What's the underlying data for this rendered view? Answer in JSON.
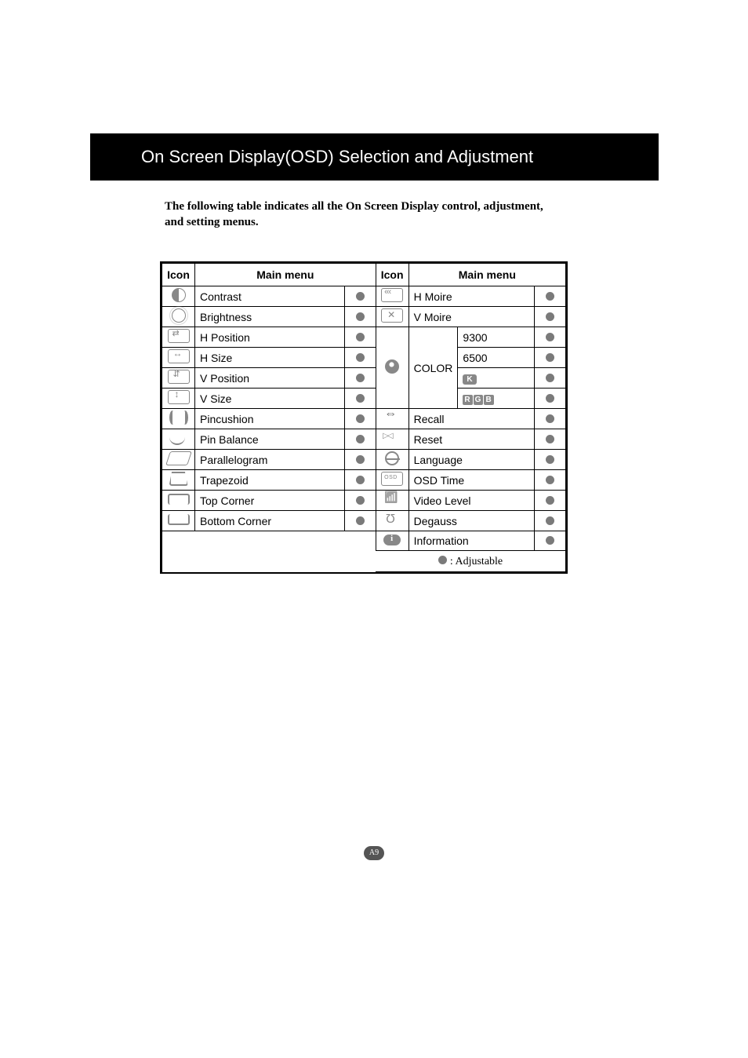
{
  "header": {
    "title": "On Screen Display(OSD) Selection and Adjustment"
  },
  "intro": "The following table indicates all the On Screen Display control, adjustment, and setting menus.",
  "table": {
    "headers": {
      "icon1": "Icon",
      "menu1": "Main menu",
      "icon2": "Icon",
      "menu2": "Main menu"
    },
    "left": [
      {
        "icon": "contrast",
        "label": "Contrast"
      },
      {
        "icon": "brightness",
        "label": "Brightness"
      },
      {
        "icon": "hpos",
        "label": "H Position"
      },
      {
        "icon": "hsize",
        "label": "H Size"
      },
      {
        "icon": "vpos",
        "label": "V Position"
      },
      {
        "icon": "vsize",
        "label": "V Size"
      },
      {
        "icon": "pincushion",
        "label": "Pincushion"
      },
      {
        "icon": "pinbal",
        "label": "Pin Balance"
      },
      {
        "icon": "para",
        "label": "Parallelogram"
      },
      {
        "icon": "trap",
        "label": "Trapezoid"
      },
      {
        "icon": "topcorner",
        "label": "Top Corner"
      },
      {
        "icon": "botcorner",
        "label": "Bottom Corner"
      }
    ],
    "right_top": [
      {
        "icon": "hmoire",
        "label": "H Moire"
      },
      {
        "icon": "vmoire",
        "label": "V Moire"
      }
    ],
    "color": {
      "icon": "color",
      "group_label": "COLOR",
      "options": [
        "9300",
        "6500",
        "K_BADGE",
        "RGB_BADGE"
      ]
    },
    "right_bottom": [
      {
        "icon": "recall",
        "label": "Recall"
      },
      {
        "icon": "reset",
        "label": "Reset"
      },
      {
        "icon": "lang",
        "label": "Language"
      },
      {
        "icon": "osdtime",
        "label": "OSD Time"
      },
      {
        "icon": "video",
        "label": "Video Level"
      },
      {
        "icon": "degauss",
        "label": "Degauss"
      },
      {
        "icon": "info",
        "label": "Information"
      }
    ]
  },
  "legend": {
    "symbol": "●",
    "text": ": Adjustable"
  },
  "page_number": "A9"
}
